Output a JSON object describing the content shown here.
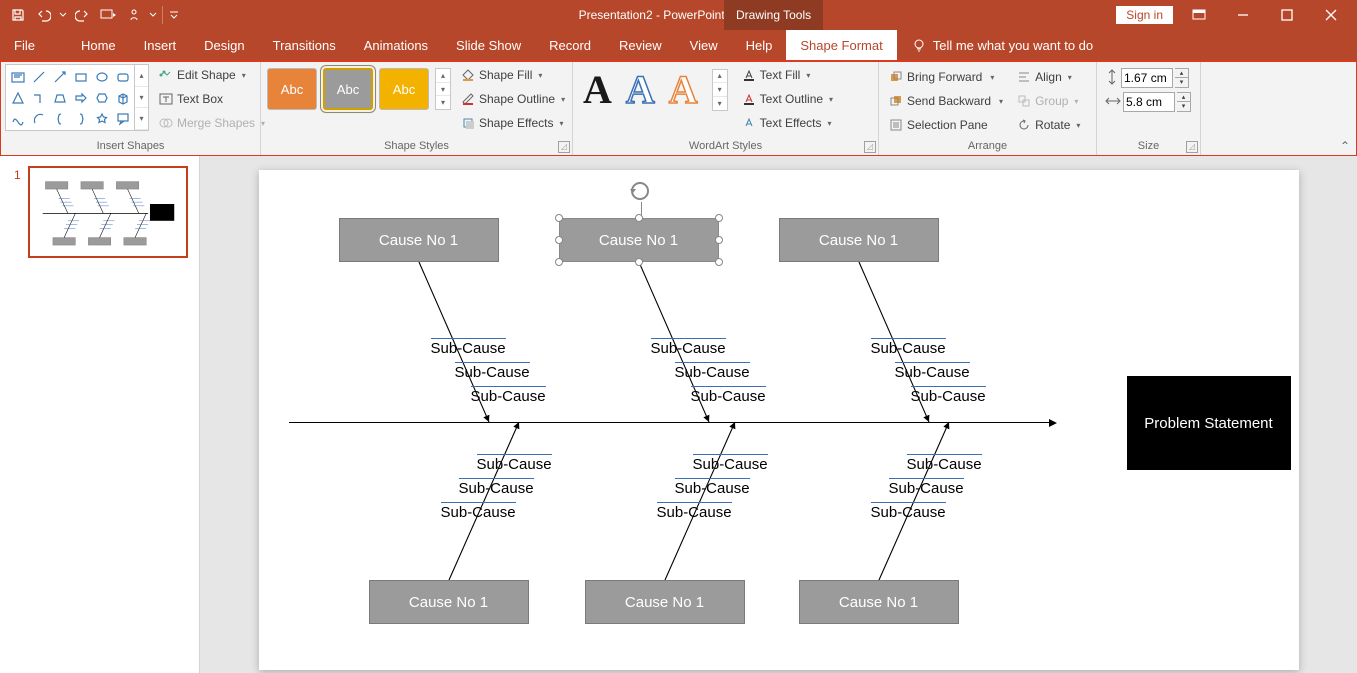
{
  "titlebar": {
    "title": "Presentation2 - PowerPoint",
    "contextual_tab": "Drawing Tools",
    "sign_in": "Sign in"
  },
  "menu": {
    "tabs": [
      "File",
      "Home",
      "Insert",
      "Design",
      "Transitions",
      "Animations",
      "Slide Show",
      "Record",
      "Review",
      "View",
      "Help",
      "Shape Format"
    ],
    "active": "Shape Format",
    "tell_me": "Tell me what you want to do"
  },
  "ribbon": {
    "insert_shapes": {
      "label": "Insert Shapes",
      "edit_shape": "Edit Shape",
      "text_box": "Text Box",
      "merge_shapes": "Merge Shapes"
    },
    "shape_styles": {
      "label": "Shape Styles",
      "swatch_text": "Abc",
      "shape_fill": "Shape Fill",
      "shape_outline": "Shape Outline",
      "shape_effects": "Shape Effects"
    },
    "wordart_styles": {
      "label": "WordArt Styles",
      "letter": "A",
      "text_fill": "Text Fill",
      "text_outline": "Text Outline",
      "text_effects": "Text Effects"
    },
    "arrange": {
      "label": "Arrange",
      "bring_forward": "Bring Forward",
      "send_backward": "Send Backward",
      "selection_pane": "Selection Pane",
      "align": "Align",
      "group": "Group",
      "rotate": "Rotate"
    },
    "size": {
      "label": "Size",
      "height": "1.67 cm",
      "width": "5.8 cm"
    }
  },
  "thumbs": {
    "slide1_num": "1"
  },
  "diagram": {
    "cause_label": "Cause No 1",
    "sub_label": "Sub-Cause",
    "problem": "Problem Statement"
  },
  "chart_data": {
    "type": "diagram",
    "diagram_type": "fishbone",
    "head": "Problem Statement",
    "bones": [
      {
        "side": "top",
        "label": "Cause No 1",
        "subs": [
          "Sub-Cause",
          "Sub-Cause",
          "Sub-Cause"
        ]
      },
      {
        "side": "top",
        "label": "Cause No 1",
        "subs": [
          "Sub-Cause",
          "Sub-Cause",
          "Sub-Cause"
        ],
        "selected": true
      },
      {
        "side": "top",
        "label": "Cause No 1",
        "subs": [
          "Sub-Cause",
          "Sub-Cause",
          "Sub-Cause"
        ]
      },
      {
        "side": "bottom",
        "label": "Cause No 1",
        "subs": [
          "Sub-Cause",
          "Sub-Cause",
          "Sub-Cause"
        ]
      },
      {
        "side": "bottom",
        "label": "Cause No 1",
        "subs": [
          "Sub-Cause",
          "Sub-Cause",
          "Sub-Cause"
        ]
      },
      {
        "side": "bottom",
        "label": "Cause No 1",
        "subs": [
          "Sub-Cause",
          "Sub-Cause",
          "Sub-Cause"
        ]
      }
    ]
  }
}
